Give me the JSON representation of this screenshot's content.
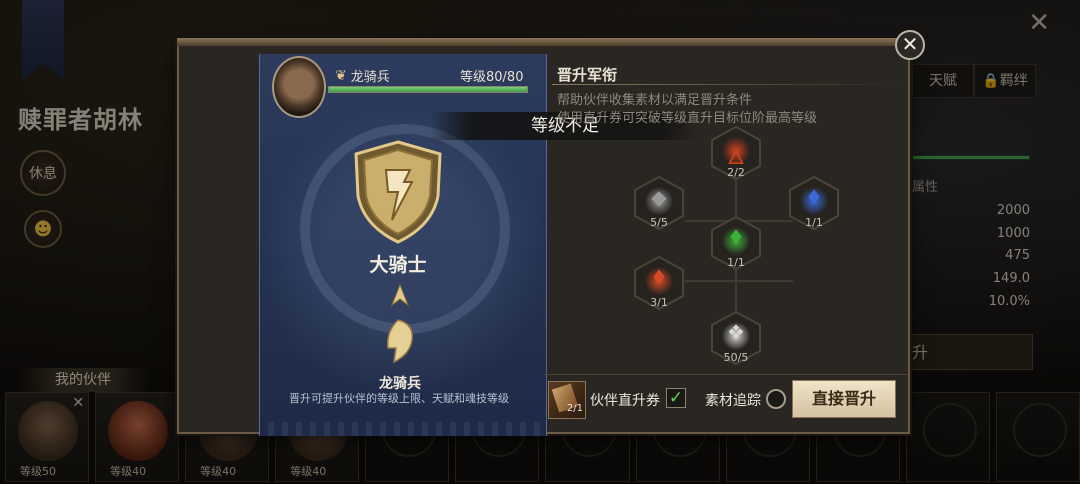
{
  "background": {
    "hero_name": "赎罪者胡林",
    "rest_button": "休息",
    "partner_tab": "我的伙伴",
    "tabs": [
      "天赋",
      "🔒羁绊"
    ],
    "attr_title": "属性",
    "stats": [
      "2000",
      "1000",
      "475",
      "149.0",
      "10.0%"
    ],
    "upgrade_button": "升",
    "partner_cards": [
      {
        "level": "等级50"
      },
      {
        "level": "等级40"
      },
      {
        "level": "等级40"
      },
      {
        "level": "等级40"
      }
    ]
  },
  "dialog": {
    "header": {
      "class_name": "龙骑兵",
      "level_text": "等级80/80",
      "xp_fraction": 1.0
    },
    "insufficient_level": "等级不足",
    "target_rank_name": "大骑士",
    "current_rank_name": "龙骑兵",
    "promote_tip": "晋升可提升伙伴的等级上限、天赋和魂技等级",
    "right": {
      "title": "晋升军衔",
      "desc_line1": "帮助伙伴收集素材以满足晋升条件",
      "desc_line2": "使用直升券可突破等级直升目标位阶最高等级"
    },
    "materials": [
      {
        "name": "flame-feather",
        "count": "2/2",
        "color": "#d0441c"
      },
      {
        "name": "ore",
        "count": "5/5",
        "color": "#9a9a9a"
      },
      {
        "name": "blue-flame",
        "count": "1/1",
        "color": "#3b6ad8"
      },
      {
        "name": "green-flame",
        "count": "1/1",
        "color": "#3fb03a"
      },
      {
        "name": "red-flame",
        "count": "3/1",
        "color": "#d84a26"
      },
      {
        "name": "crystal-dust",
        "count": "50/5",
        "color": "#d8d8d8"
      }
    ],
    "ticket": {
      "count": "2/1",
      "label": "伙伴直升券",
      "checked": "✓"
    },
    "trace_label": "素材追踪",
    "promote_button": "直接晋升",
    "close": "✕"
  }
}
